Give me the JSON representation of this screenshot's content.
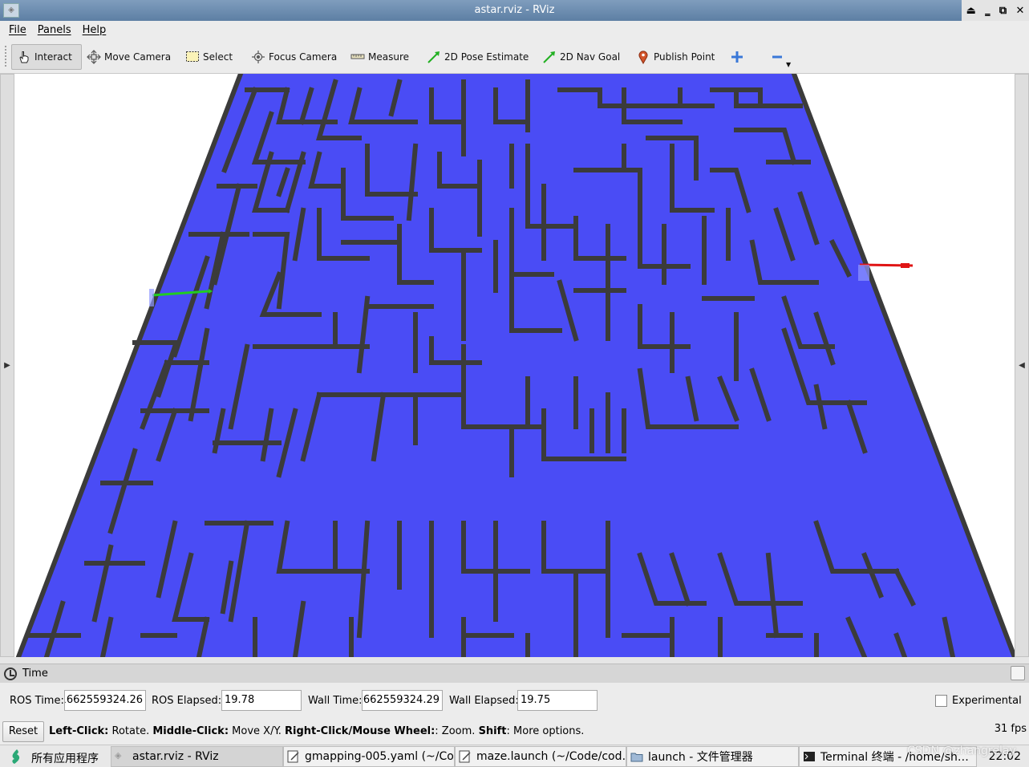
{
  "window": {
    "title": "astar.rviz - RViz"
  },
  "menu": [
    "File",
    "Panels",
    "Help"
  ],
  "toolbar": {
    "tools": [
      {
        "label": "Interact",
        "icon": "hand-pointer-icon",
        "active": true
      },
      {
        "label": "Move Camera",
        "icon": "move-camera-icon"
      },
      {
        "label": "Select",
        "icon": "select-box-icon"
      },
      {
        "label": "Focus Camera",
        "icon": "focus-camera-icon"
      },
      {
        "label": "Measure",
        "icon": "ruler-icon"
      },
      {
        "label": "2D Pose Estimate",
        "icon": "green-arrow-icon"
      },
      {
        "label": "2D Nav Goal",
        "icon": "green-arrow-icon"
      },
      {
        "label": "Publish Point",
        "icon": "map-pin-icon"
      }
    ],
    "add_icon": "plus-icon",
    "remove_icon": "minus-icon"
  },
  "viewport": {
    "map_color": "#4a4cf5",
    "wall_color": "#3b3b3b",
    "start_arrow_color": "#22cc22",
    "goal_arrow_color": "#e01515"
  },
  "time_panel": {
    "title": "Time",
    "ros_time_label": "ROS Time:",
    "ros_time": "1662559324.26",
    "ros_elapsed_label": "ROS Elapsed:",
    "ros_elapsed": "19.78",
    "wall_time_label": "Wall Time:",
    "wall_time": "1662559324.29",
    "wall_elapsed_label": "Wall Elapsed:",
    "wall_elapsed": "19.75",
    "experimental_label": "Experimental",
    "experimental_checked": false
  },
  "status": {
    "reset_label": "Reset",
    "help_parts": [
      {
        "bold": "Left-Click:",
        "text": " Rotate. "
      },
      {
        "bold": "Middle-Click:",
        "text": " Move X/Y. "
      },
      {
        "bold": "Right-Click/Mouse Wheel:",
        "text": ": Zoom. "
      },
      {
        "bold": "Shift",
        "text": ": More options."
      }
    ],
    "fps": "31 fps"
  },
  "taskbar": {
    "start_label": "所有应用程序",
    "tasks": [
      {
        "label": "astar.rviz - RViz",
        "active": true
      },
      {
        "label": "gmapping-005.yaml (~/Co…"
      },
      {
        "label": "maze.launch (~/Code/cod…"
      },
      {
        "label": "launch - 文件管理器"
      },
      {
        "label": "Terminal 终端 - /home/sh…"
      }
    ],
    "clock": "22:02",
    "watermark": "CSDN @zhangrelay"
  }
}
